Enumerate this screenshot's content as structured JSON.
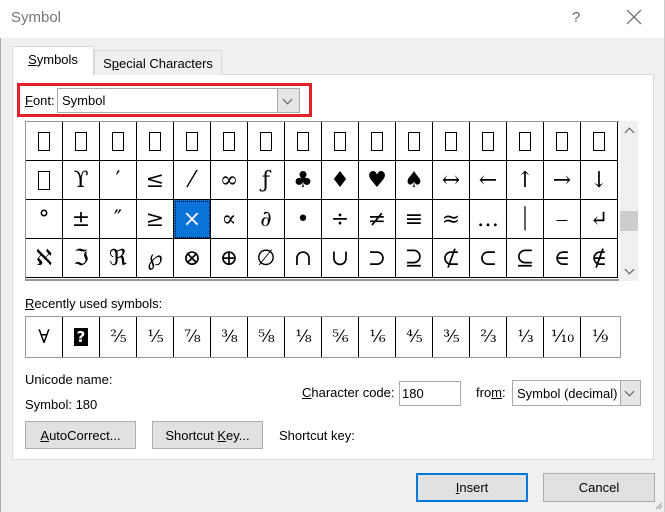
{
  "window": {
    "title": "Symbol",
    "help_label": "?",
    "close_icon": "close-icon"
  },
  "tabs": [
    {
      "label": "Symbols",
      "mnemonic": "S",
      "rest": "ymbols",
      "active": true
    },
    {
      "label": "Special Characters",
      "pre": "S",
      "mnemonic": "p",
      "rest": "ecial Characters",
      "active": false
    }
  ],
  "font": {
    "label_mnemonic": "F",
    "label_rest": "ont:",
    "value": "Symbol",
    "highlight_color": "#e0202a"
  },
  "symbol_grid": {
    "rows": [
      [
        "□",
        "□",
        "□",
        "□",
        "□",
        "□",
        "□",
        "□",
        "□",
        "□",
        "□",
        "□",
        "□",
        "□",
        "□",
        "□"
      ],
      [
        "□",
        "ϒ",
        "′",
        "≤",
        "⁄",
        "∞",
        "ƒ",
        "♣",
        "♦",
        "♥",
        "♠",
        "↔",
        "←",
        "↑",
        "→",
        "↓"
      ],
      [
        "°",
        "±",
        "″",
        "≥",
        "×",
        "∝",
        "∂",
        "•",
        "÷",
        "≠",
        "≡",
        "≈",
        "…",
        "⏐",
        "⎯",
        "↵"
      ],
      [
        "ℵ",
        "ℑ",
        "ℜ",
        "℘",
        "⊗",
        "⊕",
        "∅",
        "∩",
        "∪",
        "⊃",
        "⊇",
        "⊄",
        "⊂",
        "⊆",
        "∈",
        "∉"
      ]
    ],
    "selected": {
      "row": 2,
      "col": 4,
      "char": "×"
    },
    "selected_color": "#0a74d9"
  },
  "recent": {
    "label_mnemonic": "R",
    "label_rest": "ecently used symbols:",
    "items": [
      "∀",
      "?",
      "⅖",
      "⅕",
      "⅞",
      "⅜",
      "⅝",
      "⅛",
      "⅚",
      "⅙",
      "⅘",
      "⅗",
      "⅔",
      "⅓",
      "⅒",
      "⅑"
    ]
  },
  "info": {
    "unicode_name_label": "Unicode name:",
    "symbol_value": "Symbol: 180"
  },
  "character_code": {
    "label_mnemonic": "C",
    "label_rest": "haracter code:",
    "value": "180"
  },
  "from": {
    "label_pre": "fro",
    "label_mnemonic": "m",
    "label_rest": ":",
    "value": "Symbol (decimal)"
  },
  "buttons": {
    "autocorrect_mnemonic": "A",
    "autocorrect_rest": "utoCorrect...",
    "shortcut_pre": "Shortcut ",
    "shortcut_mnemonic": "K",
    "shortcut_rest": "ey...",
    "shortcut_key_label": "Shortcut key:",
    "insert_mnemonic": "I",
    "insert_rest": "nsert",
    "cancel": "Cancel"
  }
}
